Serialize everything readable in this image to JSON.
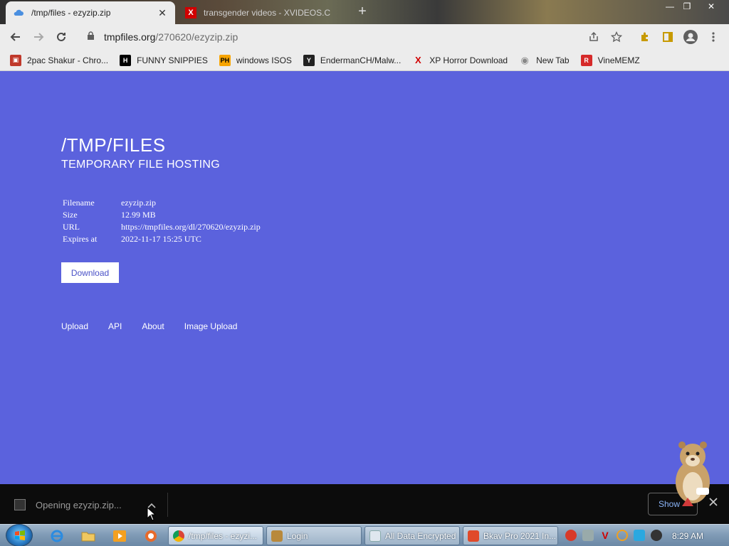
{
  "browser": {
    "tabs": [
      {
        "title": "/tmp/files - ezyzip.zip",
        "active": true,
        "close": "✕"
      },
      {
        "title": "transgender videos - XVIDEOS.C",
        "active": false,
        "icon_letter": "X"
      }
    ],
    "new_tab": "+",
    "window_controls": {
      "minimize": "—",
      "restore": "❐",
      "close": "✕"
    },
    "address": {
      "host": "tmpfiles.org",
      "path": "/270620/ezyzip.zip"
    },
    "bookmarks": [
      {
        "label": "2pac Shakur - Chro...",
        "icon": "camera-icon",
        "color": "#c0392b",
        "glyph": "▣"
      },
      {
        "label": "FUNNY SNIPPIES",
        "icon": "h-icon",
        "color": "#000000",
        "glyph": "H"
      },
      {
        "label": "windows ISOS",
        "icon": "ph-icon",
        "color": "#f7a400",
        "glyph": "PH"
      },
      {
        "label": "EndermanCH/Malw...",
        "icon": "yp-icon",
        "color": "#222222",
        "glyph": "Y"
      },
      {
        "label": "XP Horror Download",
        "icon": "x-icon",
        "color": "#d10000",
        "glyph": "X"
      },
      {
        "label": "New Tab",
        "icon": "chrome-icon",
        "color": "#888888",
        "glyph": "◉"
      },
      {
        "label": "VineMEMZ",
        "icon": "r-icon",
        "color": "#d62a2a",
        "glyph": "R"
      }
    ]
  },
  "page": {
    "title": "/TMP/FILES",
    "subtitle": "TEMPORARY FILE HOSTING",
    "info": [
      {
        "key": "Filename",
        "value": "ezyzip.zip"
      },
      {
        "key": "Size",
        "value": "12.99 MB"
      },
      {
        "key": "URL",
        "value": "https://tmpfiles.org/dl/270620/ezyzip.zip"
      },
      {
        "key": "Expires at",
        "value": "2022-11-17 15:25 UTC"
      }
    ],
    "download_label": "Download",
    "footer_links": [
      "Upload",
      "API",
      "About",
      "Image Upload"
    ],
    "background_color": "#5b62dd"
  },
  "downloads": {
    "item_status": "Opening ezyzip.zip...",
    "show_all_label": "Show"
  },
  "taskbar": {
    "tasks": [
      {
        "label": "/tmp/files - ezyzi...",
        "active": true,
        "icon_color": "#dd4b39"
      },
      {
        "label": "Login",
        "active": false,
        "icon_color": "#b8893c"
      },
      {
        "label": "All Data Encrypted",
        "active": false,
        "icon_color": "#dfe7ef"
      },
      {
        "label": "Bkav Pro 2021 In...",
        "active": false,
        "icon_color": "#e04a2a"
      }
    ],
    "clock": "8:29 AM"
  }
}
